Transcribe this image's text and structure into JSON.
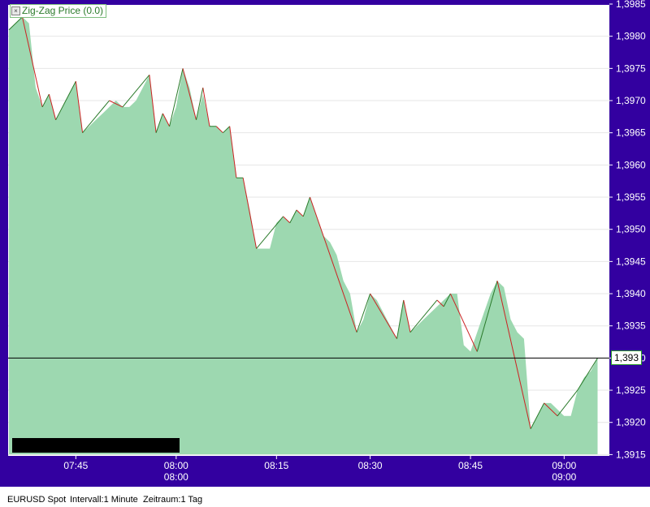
{
  "colors": {
    "frame": "#3300a0",
    "area_fill": "#9dd8b0",
    "zigzag_up": "#2a7a2a",
    "zigzag_down": "#cc2222",
    "current_line": "#000000",
    "grid": "#e6e6e6"
  },
  "legend": {
    "icon": "close-box-icon",
    "label": "Zig-Zag Price (0.0)"
  },
  "price_marker": "1,393",
  "status": {
    "symbol": "EURUSD Spot",
    "interval": "Intervall:1 Minute",
    "range": "Zeitraum:1 Tag"
  },
  "chart_data": {
    "type": "area",
    "title": "",
    "series": [
      {
        "values": [
          1.3981,
          1.3982,
          1.3983,
          1.3982,
          1.3972,
          1.3969,
          1.3971,
          1.3967,
          1.3969,
          1.3971,
          1.3973,
          1.3965,
          1.3966,
          1.3967,
          1.3968,
          1.3969,
          1.397,
          1.3969,
          1.3969,
          1.397,
          1.3972,
          1.3974,
          1.3965,
          1.3968,
          1.3966,
          1.3969,
          1.3975,
          1.3972,
          1.3967,
          1.3971,
          1.3966,
          1.3966,
          1.3965,
          1.3966,
          1.3958,
          1.3958,
          1.3953,
          1.3947,
          1.3947,
          1.3947,
          1.3951,
          1.3952,
          1.3951,
          1.3953,
          1.3952,
          1.3955,
          1.3952,
          1.3949,
          1.3948,
          1.3946,
          1.3942,
          1.394,
          1.3934,
          1.3936,
          1.394,
          1.3939,
          1.3937,
          1.3935,
          1.3933,
          1.3939,
          1.3934,
          1.3935,
          1.3936,
          1.3937,
          1.3938,
          1.3939,
          1.394,
          1.394,
          1.3932,
          1.3931,
          1.3934,
          1.3937,
          1.394,
          1.3942,
          1.3941,
          1.3936,
          1.3934,
          1.3933,
          1.3919,
          1.3921,
          1.3923,
          1.3923,
          1.3922,
          1.3921,
          1.3921,
          1.3925,
          1.3927,
          1.3928,
          1.393
        ]
      },
      {
        "name": "Zig-Zag Price (0.0)",
        "points": [
          {
            "i": 0,
            "v": 1.3981
          },
          {
            "i": 2,
            "v": 1.3983
          },
          {
            "i": 5,
            "v": 1.3969
          },
          {
            "i": 6,
            "v": 1.3971
          },
          {
            "i": 7,
            "v": 1.3967
          },
          {
            "i": 10,
            "v": 1.3973
          },
          {
            "i": 11,
            "v": 1.3965
          },
          {
            "i": 15,
            "v": 1.397
          },
          {
            "i": 17,
            "v": 1.3969
          },
          {
            "i": 21,
            "v": 1.3974
          },
          {
            "i": 22,
            "v": 1.3965
          },
          {
            "i": 23,
            "v": 1.3968
          },
          {
            "i": 24,
            "v": 1.3966
          },
          {
            "i": 26,
            "v": 1.3975
          },
          {
            "i": 28,
            "v": 1.3967
          },
          {
            "i": 29,
            "v": 1.3972
          },
          {
            "i": 30,
            "v": 1.3966
          },
          {
            "i": 31,
            "v": 1.3966
          },
          {
            "i": 32,
            "v": 1.3965
          },
          {
            "i": 33,
            "v": 1.3966
          },
          {
            "i": 34,
            "v": 1.3958
          },
          {
            "i": 35,
            "v": 1.3958
          },
          {
            "i": 37,
            "v": 1.3947
          },
          {
            "i": 41,
            "v": 1.3952
          },
          {
            "i": 42,
            "v": 1.3951
          },
          {
            "i": 43,
            "v": 1.3953
          },
          {
            "i": 44,
            "v": 1.3952
          },
          {
            "i": 45,
            "v": 1.3955
          },
          {
            "i": 52,
            "v": 1.3934
          },
          {
            "i": 54,
            "v": 1.394
          },
          {
            "i": 58,
            "v": 1.3933
          },
          {
            "i": 59,
            "v": 1.3939
          },
          {
            "i": 60,
            "v": 1.3934
          },
          {
            "i": 64,
            "v": 1.3939
          },
          {
            "i": 65,
            "v": 1.3938
          },
          {
            "i": 66,
            "v": 1.394
          },
          {
            "i": 70,
            "v": 1.3931
          },
          {
            "i": 73,
            "v": 1.3942
          },
          {
            "i": 78,
            "v": 1.3919
          },
          {
            "i": 80,
            "v": 1.3923
          },
          {
            "i": 82,
            "v": 1.3921
          },
          {
            "i": 85,
            "v": 1.3925
          },
          {
            "i": 88,
            "v": 1.393
          }
        ]
      }
    ],
    "current_value": 1.393,
    "x_ticks": [
      {
        "i": 10,
        "label": "07:45",
        "label2": ""
      },
      {
        "i": 25,
        "label": "08:00",
        "label2": "08:00"
      },
      {
        "i": 40,
        "label": "08:15",
        "label2": ""
      },
      {
        "i": 54,
        "label": "08:30",
        "label2": ""
      },
      {
        "i": 69,
        "label": "08:45",
        "label2": ""
      },
      {
        "i": 83,
        "label": "09:00",
        "label2": "09:00"
      }
    ],
    "y_ticks": [
      "1,3985",
      "1,3980",
      "1,3975",
      "1,3970",
      "1,3965",
      "1,3960",
      "1,3955",
      "1,3950",
      "1,3945",
      "1,3940",
      "1,3935",
      "1,3930",
      "1,3925",
      "1,3920",
      "1,3915"
    ],
    "ylim": [
      1.3915,
      1.3985
    ],
    "grid": true,
    "legend_position": "top-left"
  }
}
